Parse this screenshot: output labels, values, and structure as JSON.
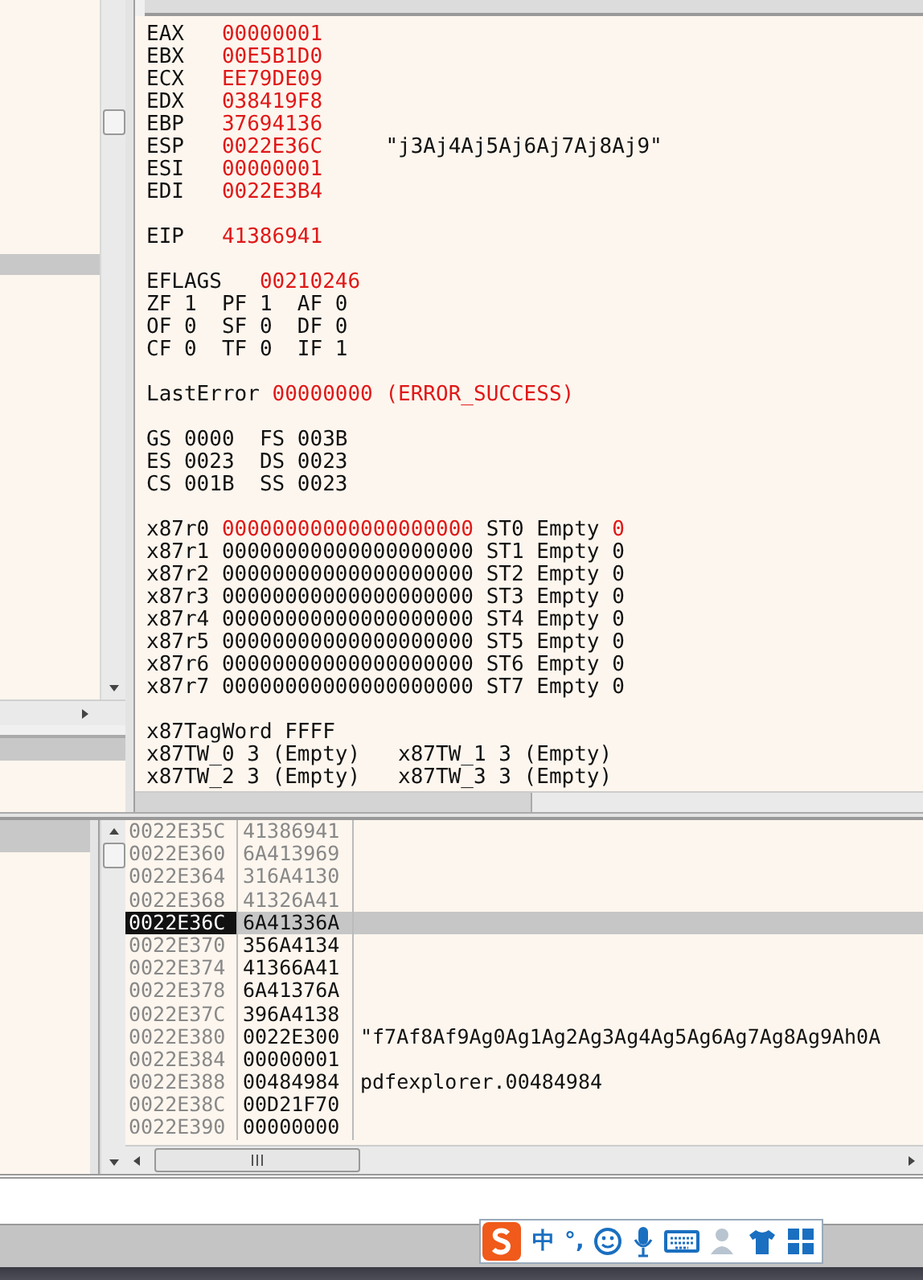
{
  "registers": {
    "groups": [
      {
        "kind": "registers",
        "lines": [
          {
            "segments": [
              {
                "text": "EAX",
                "red": false
              },
              {
                "text": "00000001",
                "red": true
              }
            ]
          },
          {
            "segments": [
              {
                "text": "EBX",
                "red": false
              },
              {
                "text": "00E5B1D0",
                "red": true
              }
            ]
          },
          {
            "segments": [
              {
                "text": "ECX",
                "red": false
              },
              {
                "text": "EE79DE09",
                "red": true
              }
            ]
          },
          {
            "segments": [
              {
                "text": "EDX",
                "red": false
              },
              {
                "text": "038419F8",
                "red": true
              }
            ]
          },
          {
            "segments": [
              {
                "text": "EBP",
                "red": false
              },
              {
                "text": "37694136",
                "red": true
              }
            ]
          },
          {
            "segments": [
              {
                "text": "ESP",
                "red": false
              },
              {
                "text": "0022E36C",
                "red": true
              },
              {
                "text": "\"j3Aj4Aj5Aj6Aj7Aj8Aj9\"",
                "red": false
              }
            ]
          },
          {
            "segments": [
              {
                "text": "ESI",
                "red": false
              },
              {
                "text": "00000001",
                "red": true
              }
            ]
          },
          {
            "segments": [
              {
                "text": "EDI",
                "red": false
              },
              {
                "text": "0022E3B4",
                "red": true
              }
            ]
          }
        ]
      },
      {
        "kind": "registers",
        "lines": [
          {
            "segments": [
              {
                "text": "EIP",
                "red": false
              },
              {
                "text": "41386941",
                "red": true
              }
            ]
          }
        ]
      },
      {
        "kind": "eflags",
        "lines": [
          {
            "segments": [
              {
                "text": "EFLAGS",
                "red": false
              },
              {
                "text": "00210246",
                "red": true
              }
            ]
          },
          {
            "segments": [
              {
                "text": "ZF 1  PF 1  AF 0",
                "red": false
              }
            ]
          },
          {
            "segments": [
              {
                "text": "OF 0  SF 0  DF 0",
                "red": false
              }
            ]
          },
          {
            "segments": [
              {
                "text": "CF 0  TF 0  IF 1",
                "red": false
              }
            ]
          }
        ]
      },
      {
        "kind": "plain",
        "lines": [
          {
            "segments": [
              {
                "text": "LastError",
                "red": false
              },
              {
                "text": "00000000 (ERROR_SUCCESS)",
                "red": true
              }
            ]
          }
        ]
      },
      {
        "kind": "plain",
        "lines": [
          {
            "segments": [
              {
                "text": "GS 0000  FS 003B",
                "red": false
              }
            ]
          },
          {
            "segments": [
              {
                "text": "ES 0023  DS 0023",
                "red": false
              }
            ]
          },
          {
            "segments": [
              {
                "text": "CS 001B  SS 0023",
                "red": false
              }
            ]
          }
        ]
      },
      {
        "kind": "plain",
        "lines": [
          {
            "segments": [
              {
                "text": "x87r0",
                "red": false
              },
              {
                "text": "00000000000000000000",
                "red": true
              },
              {
                "text": "ST0 Empty",
                "red": false
              },
              {
                "text": "0",
                "red": true
              }
            ]
          },
          {
            "segments": [
              {
                "text": "x87r1",
                "red": false
              },
              {
                "text": "00000000000000000000",
                "red": false
              },
              {
                "text": "ST1 Empty",
                "red": false
              },
              {
                "text": "0",
                "red": false
              }
            ]
          },
          {
            "segments": [
              {
                "text": "x87r2",
                "red": false
              },
              {
                "text": "00000000000000000000",
                "red": false
              },
              {
                "text": "ST2 Empty",
                "red": false
              },
              {
                "text": "0",
                "red": false
              }
            ]
          },
          {
            "segments": [
              {
                "text": "x87r3",
                "red": false
              },
              {
                "text": "00000000000000000000",
                "red": false
              },
              {
                "text": "ST3 Empty",
                "red": false
              },
              {
                "text": "0",
                "red": false
              }
            ]
          },
          {
            "segments": [
              {
                "text": "x87r4",
                "red": false
              },
              {
                "text": "00000000000000000000",
                "red": false
              },
              {
                "text": "ST4 Empty",
                "red": false
              },
              {
                "text": "0",
                "red": false
              }
            ]
          },
          {
            "segments": [
              {
                "text": "x87r5",
                "red": false
              },
              {
                "text": "00000000000000000000",
                "red": false
              },
              {
                "text": "ST5 Empty",
                "red": false
              },
              {
                "text": "0",
                "red": false
              }
            ]
          },
          {
            "segments": [
              {
                "text": "x87r6",
                "red": false
              },
              {
                "text": "00000000000000000000",
                "red": false
              },
              {
                "text": "ST6 Empty",
                "red": false
              },
              {
                "text": "0",
                "red": false
              }
            ]
          },
          {
            "segments": [
              {
                "text": "x87r7",
                "red": false
              },
              {
                "text": "00000000000000000000",
                "red": false
              },
              {
                "text": "ST7 Empty",
                "red": false
              },
              {
                "text": "0",
                "red": false
              }
            ]
          }
        ]
      },
      {
        "kind": "plain",
        "lines": [
          {
            "segments": [
              {
                "text": "x87TagWord FFFF",
                "red": false
              }
            ]
          },
          {
            "segments": [
              {
                "text": "x87TW_0 3 (Empty)   x87TW_1 3 (Empty)",
                "red": false
              }
            ]
          },
          {
            "segments": [
              {
                "text": "x87TW_2 3 (Empty)   x87TW_3 3 (Empty)",
                "red": false
              }
            ]
          }
        ]
      }
    ]
  },
  "stack": {
    "rows": [
      {
        "address": "0022E35C",
        "value": "41386941",
        "dimmed": true,
        "selected": false
      },
      {
        "address": "0022E360",
        "value": "6A413969",
        "dimmed": true,
        "selected": false
      },
      {
        "address": "0022E364",
        "value": "316A4130",
        "dimmed": true,
        "selected": false
      },
      {
        "address": "0022E368",
        "value": "41326A41",
        "dimmed": true,
        "selected": false
      },
      {
        "address": "0022E36C",
        "value": "6A41336A",
        "dimmed": false,
        "selected": true
      },
      {
        "address": "0022E370",
        "value": "356A4134",
        "dimmed": false,
        "selected": false
      },
      {
        "address": "0022E374",
        "value": "41366A41",
        "dimmed": false,
        "selected": false
      },
      {
        "address": "0022E378",
        "value": "6A41376A",
        "dimmed": false,
        "selected": false
      },
      {
        "address": "0022E37C",
        "value": "396A4138",
        "dimmed": false,
        "selected": false
      },
      {
        "address": "0022E380",
        "value": "0022E300",
        "comment": "\"f7Af8Af9Ag0Ag1Ag2Ag3Ag4Ag5Ag6Ag7Ag8Ag9Ah0A",
        "dimmed": false,
        "selected": false
      },
      {
        "address": "0022E384",
        "value": "00000001",
        "dimmed": false,
        "selected": false
      },
      {
        "address": "0022E388",
        "value": "00484984",
        "comment": "pdfexplorer.00484984",
        "dimmed": false,
        "selected": false
      },
      {
        "address": "0022E38C",
        "value": "00D21F70",
        "dimmed": false,
        "selected": false
      },
      {
        "address": "0022E390",
        "value": "00000000",
        "dimmed": false,
        "selected": false
      }
    ]
  },
  "ime_toolbar": {
    "items": [
      {
        "kind": "logo"
      },
      {
        "kind": "text",
        "text": "中"
      },
      {
        "kind": "text",
        "text": "°,"
      },
      {
        "kind": "smiley"
      },
      {
        "kind": "microphone"
      },
      {
        "kind": "keyboard"
      },
      {
        "kind": "person"
      },
      {
        "kind": "shirt"
      },
      {
        "kind": "grid"
      }
    ]
  }
}
